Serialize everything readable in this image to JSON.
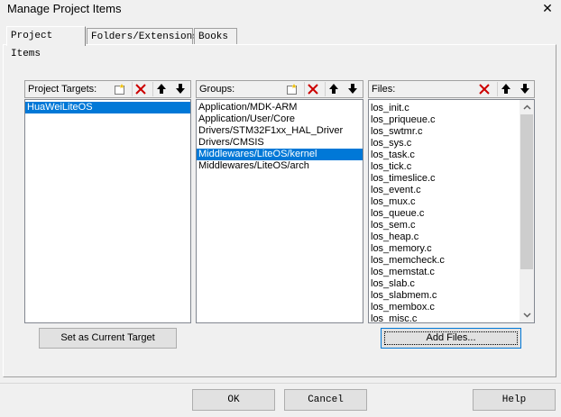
{
  "window": {
    "title": "Manage Project Items",
    "close_glyph": "✕"
  },
  "tabs": [
    {
      "label": "Project Items",
      "active": true
    },
    {
      "label": "Folders/Extensions",
      "active": false
    },
    {
      "label": "Books",
      "active": false
    }
  ],
  "targets": {
    "label": "Project Targets:",
    "items": [
      "HuaWeiLiteOS"
    ],
    "selected_index": 0
  },
  "groups": {
    "label": "Groups:",
    "items": [
      "Application/MDK-ARM",
      "Application/User/Core",
      "Drivers/STM32F1xx_HAL_Driver",
      "Drivers/CMSIS",
      "Middlewares/LiteOS/kernel",
      "Middlewares/LiteOS/arch"
    ],
    "selected_index": 4
  },
  "files": {
    "label": "Files:",
    "items": [
      "los_init.c",
      "los_priqueue.c",
      "los_swtmr.c",
      "los_sys.c",
      "los_task.c",
      "los_tick.c",
      "los_timeslice.c",
      "los_event.c",
      "los_mux.c",
      "los_queue.c",
      "los_sem.c",
      "los_heap.c",
      "los_memory.c",
      "los_memcheck.c",
      "los_memstat.c",
      "los_slab.c",
      "los_slabmem.c",
      "los_membox.c",
      "los_misc.c"
    ]
  },
  "buttons": {
    "set_current": "Set as Current Target",
    "add_files": "Add Files...",
    "ok": "OK",
    "cancel": "Cancel",
    "help": "Help"
  },
  "colors": {
    "selection": "#0078d7",
    "delete_icon": "#cc0000"
  }
}
